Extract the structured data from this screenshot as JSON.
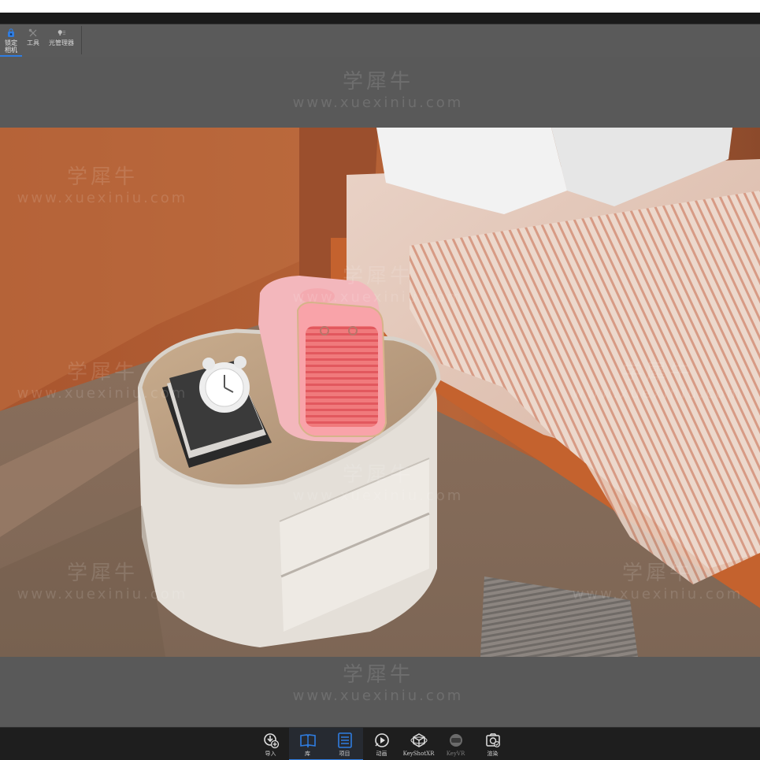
{
  "colors": {
    "accent": "#2f7de1",
    "toolbar_bg": "#1e1e1e",
    "viewport_bg": "#595959"
  },
  "toolbar": {
    "items": [
      {
        "label": "锁定\n相机",
        "icon": "camera-lock-icon",
        "active": true
      },
      {
        "label": "工具",
        "icon": "tools-icon",
        "active": false
      },
      {
        "label": "光管理器",
        "icon": "light-manager-icon",
        "active": false
      }
    ]
  },
  "watermark": {
    "cn": "学犀牛",
    "en": "www.xuexiniu.com"
  },
  "bottombar": {
    "items": [
      {
        "label": "导入",
        "icon": "import-icon",
        "active": false
      },
      {
        "label": "库",
        "icon": "library-icon",
        "active": true
      },
      {
        "label": "项目",
        "icon": "project-icon",
        "active": true
      },
      {
        "label": "动画",
        "icon": "animation-icon",
        "active": false
      },
      {
        "label": "KeyShotXR",
        "icon": "keyshotxr-icon",
        "active": false
      },
      {
        "label": "KeyVR",
        "icon": "keyvr-icon",
        "active": false,
        "dim": true
      },
      {
        "label": "渲染",
        "icon": "render-icon",
        "active": false
      }
    ]
  }
}
